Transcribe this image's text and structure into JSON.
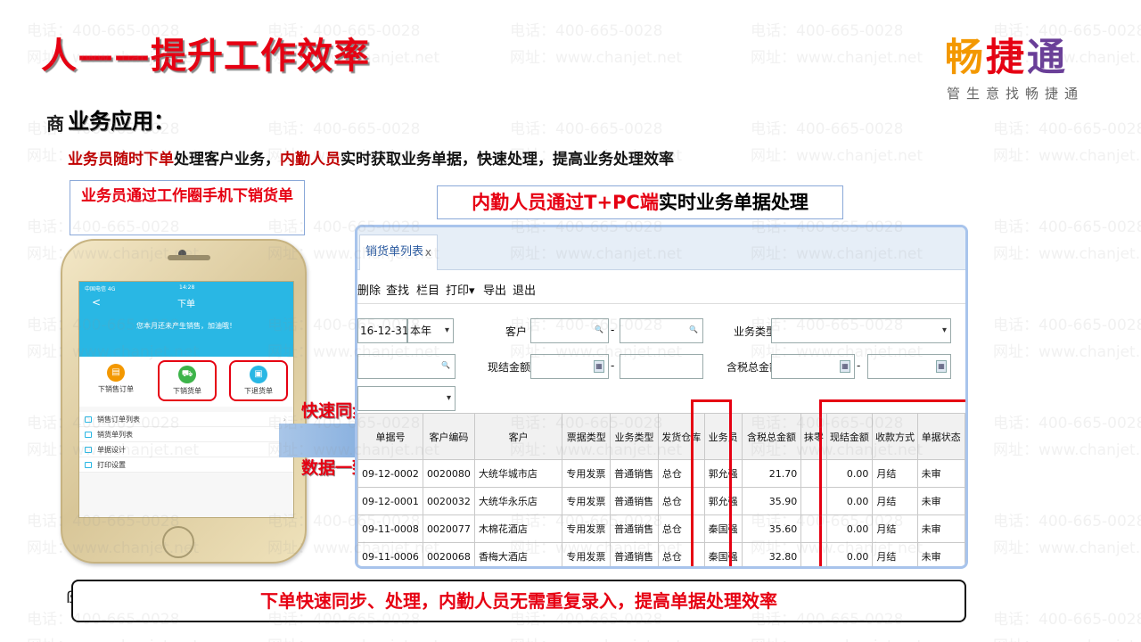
{
  "slide": {
    "title": "人——提升工作效率",
    "logo": {
      "c1": "畅",
      "c2": "捷",
      "c3": "通",
      "slogan": "管生意找畅捷通"
    },
    "section_label": "业务应用：",
    "side_char_top": "商",
    "side_char_bottom": "ß",
    "desc": {
      "part1": "业务员随时下单",
      "part2": "处理客户业务，",
      "part3": "内勤人员",
      "part4": "实时获取业务单据，快速处理，提高业务处理效率"
    },
    "caption_left": "业务员通过工作圈手机下销货单",
    "caption_right": {
      "red": "内勤人员通过T+PC端",
      "black": "实时业务单据处理"
    },
    "sync_label_1": "快速同步",
    "sync_label_2": "数据一致",
    "bottom_text": "下单快速同步、处理，内勤人员无需重复录入，提高单据处理效率",
    "watermark": {
      "phone": "电话：400-665-0028",
      "site": "网址：www.chanjet.net"
    }
  },
  "phone": {
    "status_left": "中国电信 4G",
    "time": "14:28",
    "back": "<",
    "title": "下单",
    "message": "您本月还未产生销售，加油哦！",
    "buttons": [
      {
        "label": "下销售订单",
        "icon": "clipboard-icon",
        "color": "#f39800"
      },
      {
        "label": "下销货单",
        "icon": "cart-icon",
        "color": "#3db44a"
      },
      {
        "label": "下退货单",
        "icon": "return-icon",
        "color": "#29b7e4"
      }
    ],
    "menu": [
      "销售订单列表",
      "销货单列表",
      "单据设计",
      "打印设置"
    ]
  },
  "pc": {
    "tab_label": "销货单列表",
    "tab_close": "x",
    "toolbar": [
      "删除",
      "查找",
      "栏目",
      "打印▾",
      "导出",
      "退出"
    ],
    "filter": {
      "date_value": "16-12-31",
      "period_value": "本年",
      "customer_label": "客户",
      "biz_type_label": "业务类型",
      "cash_label": "现结金额",
      "tax_total_label": "含税总金额",
      "dash": "-",
      "dropdown": "▾",
      "search_glyph": "🔍",
      "calc_glyph": "▦"
    },
    "table": {
      "headers": [
        "单据号",
        "客户编码",
        "客户",
        "票据类型",
        "业务类型",
        "发货仓库",
        "业务员",
        "含税总金额",
        "抹零",
        "现结金额",
        "收款方式",
        "单据状态"
      ],
      "rows": [
        [
          "09-12-0002",
          "0020080",
          "大统华城市店",
          "专用发票",
          "普通销售",
          "总仓",
          "郭允强",
          "21.70",
          "",
          "0.00",
          "月结",
          "未审"
        ],
        [
          "09-12-0001",
          "0020032",
          "大统华永乐店",
          "专用发票",
          "普通销售",
          "总仓",
          "郭允强",
          "35.90",
          "",
          "0.00",
          "月结",
          "未审"
        ],
        [
          "09-11-0008",
          "0020077",
          "木棉花酒店",
          "专用发票",
          "普通销售",
          "总仓",
          "秦国强",
          "35.60",
          "",
          "0.00",
          "月结",
          "未审"
        ],
        [
          "09-11-0006",
          "0020068",
          "香梅大酒店",
          "专用发票",
          "普通销售",
          "总仓",
          "秦国强",
          "32.80",
          "",
          "0.00",
          "月结",
          "未审"
        ]
      ]
    }
  },
  "colors": {
    "red": "#e60012",
    "dark_red": "#c00000",
    "phone_blue": "#29b7e4",
    "window_border": "#a8c4ec"
  }
}
